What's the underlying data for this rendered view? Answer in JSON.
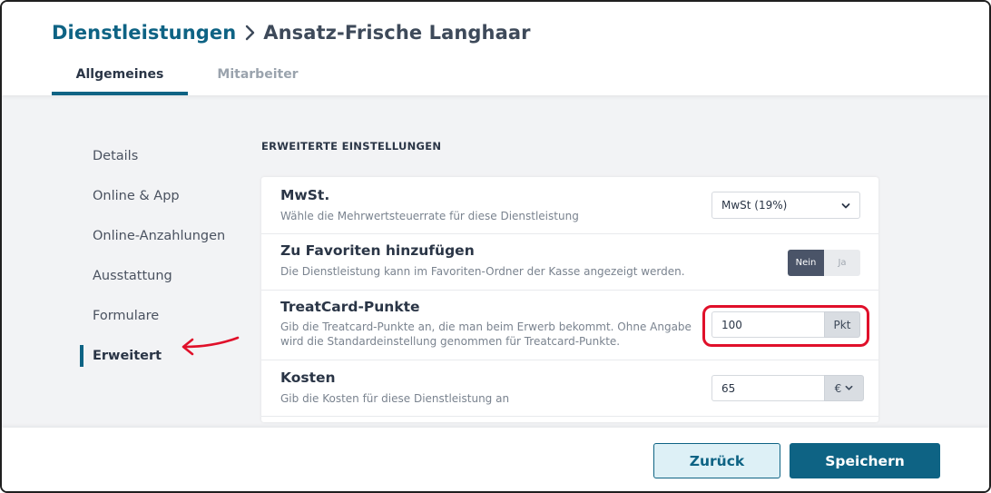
{
  "breadcrumb": {
    "parent": "Dienstleistungen",
    "current": "Ansatz-Frische Langhaar"
  },
  "tabs": [
    {
      "label": "Allgemeines",
      "active": true
    },
    {
      "label": "Mitarbeiter",
      "active": false
    }
  ],
  "sidenav": {
    "items": [
      {
        "label": "Details"
      },
      {
        "label": "Online & App"
      },
      {
        "label": "Online-Anzahlungen"
      },
      {
        "label": "Ausstattung"
      },
      {
        "label": "Formulare"
      },
      {
        "label": "Erweitert",
        "active": true
      }
    ]
  },
  "section": {
    "title": "ERWEITERTE EINSTELLUNGEN"
  },
  "settings": {
    "mwst": {
      "title": "MwSt.",
      "desc": "Wähle die Mehrwertsteuerrate für diese Dienstleistung",
      "selected": "MwSt (19%)"
    },
    "favoriten": {
      "title": "Zu Favoriten hinzufügen",
      "desc": "Die Dienstleistung kann im Favoriten-Ordner der Kasse angezeigt werden.",
      "option_no": "Nein",
      "option_yes": "Ja",
      "selected": "Nein"
    },
    "treatcard": {
      "title": "TreatCard-Punkte",
      "desc": "Gib die Treatcard-Punkte an, die man beim Erwerb bekommt. Ohne Angabe wird die Standardeinstellung genommen für Treatcard-Punkte.",
      "value": "100",
      "unit": "Pkt"
    },
    "kosten": {
      "title": "Kosten",
      "desc": "Gib die Kosten für diese Dienstleistung an",
      "value": "65",
      "currency": "€"
    }
  },
  "footer": {
    "back_label": "Zurück",
    "save_label": "Speichern"
  },
  "colors": {
    "accent": "#0e6384",
    "highlight": "#e0102a",
    "toggle_on": "#4a5468"
  },
  "icons": {
    "breadcrumb_separator": "chevron-right-icon",
    "select": "chevron-down-icon",
    "annotation": "red-arrow-icon"
  }
}
